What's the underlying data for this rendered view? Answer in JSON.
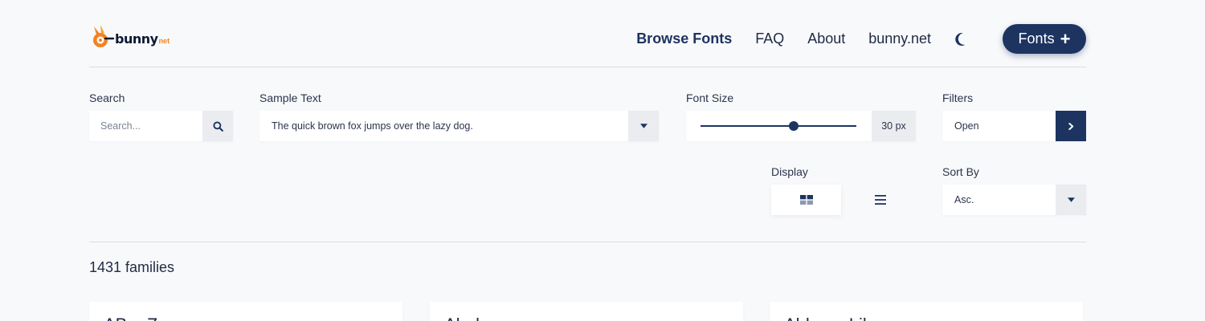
{
  "brand": {
    "word": "bunny",
    "suffix": "net"
  },
  "nav": {
    "items": [
      {
        "label": "Browse Fonts",
        "active": true
      },
      {
        "label": "FAQ",
        "active": false
      },
      {
        "label": "About",
        "active": false
      },
      {
        "label": "bunny.net",
        "active": false
      }
    ],
    "theme_icon": "moon-icon",
    "fonts_button": {
      "label": "Fonts",
      "icon": "plus-icon"
    }
  },
  "controls": {
    "search": {
      "label": "Search",
      "placeholder": "Search...",
      "icon": "search-icon"
    },
    "sample_text": {
      "label": "Sample Text",
      "value": "The quick brown fox jumps over the lazy dog.",
      "icon": "caret-down-icon"
    },
    "font_size": {
      "label": "Font Size",
      "value_text": "30 px",
      "level": 0.6
    },
    "filters": {
      "label": "Filters",
      "value": "Open",
      "icon": "chevron-right-icon"
    },
    "display": {
      "label": "Display",
      "options": [
        "grid-icon",
        "list-icon"
      ],
      "selected": "grid"
    },
    "sort": {
      "label": "Sort By",
      "value": "Asc.",
      "icon": "caret-down-icon"
    }
  },
  "results": {
    "count_text": "1431 families",
    "cards": [
      {
        "name": "ABeeZee"
      },
      {
        "name": "Abel"
      },
      {
        "name": "Abhaya Libre"
      }
    ]
  },
  "colors": {
    "accent": "#1d3461",
    "brand_orange": "#f58220",
    "background": "#f8f9fb"
  }
}
